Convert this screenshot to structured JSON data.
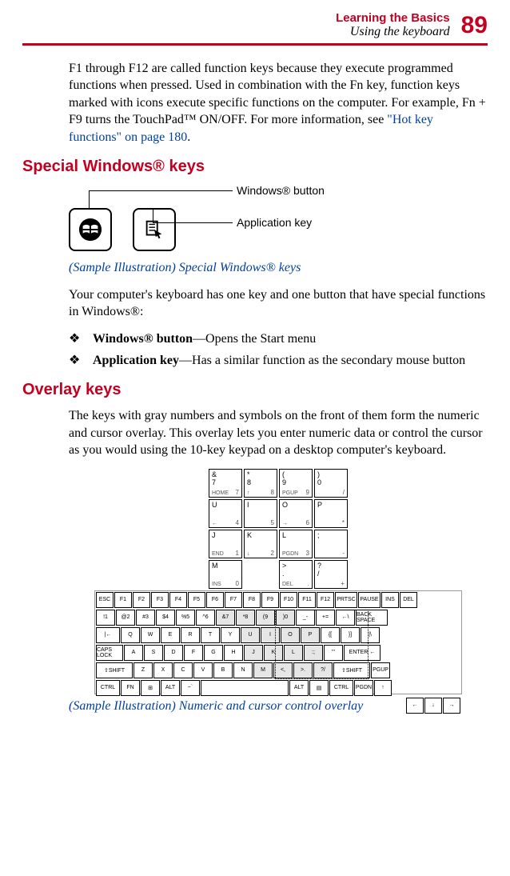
{
  "header": {
    "chapter": "Learning the Basics",
    "section": "Using the keyboard",
    "page_number": "89"
  },
  "intro": {
    "text_before_link": "F1 through F12 are called function keys because they execute programmed functions when pressed. Used in combination with the Fn key, function keys marked with icons execute specific functions on the computer. For example, Fn + F9 turns the TouchPad™ ON/OFF. For more information, see ",
    "link_text": "\"Hot key functions\" on page 180",
    "text_after_link": "."
  },
  "special_windows": {
    "heading": "Special Windows® keys",
    "fig_labels": {
      "windows_button": "Windows® button",
      "application_key": "Application key"
    },
    "caption": "(Sample Illustration) Special Windows® keys",
    "lead_in": "Your computer's keyboard has one key and one button that have special functions in Windows®:",
    "bullets": [
      {
        "strong": "Windows® button",
        "rest": "—Opens the Start menu"
      },
      {
        "strong": "Application key",
        "rest": "—Has a similar function as the secondary mouse button"
      }
    ]
  },
  "overlay": {
    "heading": "Overlay keys",
    "para": "The keys with gray numbers and symbols on the front of them form the numeric and cursor overlay. This overlay lets you enter numeric data or control the cursor as you would using the 10-key keypad on a desktop computer's keyboard.",
    "caption": "(Sample Illustration) Numeric and cursor control overlay",
    "magnified_rows": [
      [
        {
          "tl": "&",
          "sub": "7",
          "bl": "HOME",
          "br": "7"
        },
        {
          "tl": "*",
          "sub": "8",
          "bl": "↑",
          "br": "8"
        },
        {
          "tl": "(",
          "sub": "9",
          "bl": "PGUP",
          "br": "9"
        },
        {
          "tl": ")",
          "sub": "0",
          "bl": "",
          "br": "/"
        }
      ],
      [
        {
          "tl": "U",
          "bl": "←",
          "br": "4"
        },
        {
          "tl": "I",
          "bl": "",
          "br": "5"
        },
        {
          "tl": "O",
          "bl": "→",
          "br": "6"
        },
        {
          "tl": "P",
          "bl": "",
          "br": "*"
        }
      ],
      [
        {
          "tl": "J",
          "bl": "END",
          "br": "1"
        },
        {
          "tl": "K",
          "bl": "↓",
          "br": "2"
        },
        {
          "tl": "L",
          "bl": "PGDN",
          "br": "3"
        },
        {
          "tl": ";",
          "bl": "",
          "br": "-"
        }
      ],
      [
        {
          "tl": "M",
          "bl": "INS",
          "br": "0"
        },
        null,
        {
          "tl": ">",
          "sub": ".",
          "bl": "DEL",
          "br": "."
        },
        {
          "tl": "?",
          "sub": "/",
          "bl": "",
          "br": "+"
        }
      ]
    ],
    "full_keyboard_rows": [
      [
        "ESC",
        "F1",
        "F2",
        "F3",
        "F4",
        "F5",
        "F6",
        "F7",
        "F8",
        "F9",
        "F10",
        "F11",
        "F12",
        "PRTSC",
        "PAUSE",
        "INS",
        "DEL"
      ],
      [
        "!1",
        "@2",
        "#3",
        "$4",
        "%5",
        "^6",
        "&7",
        "*8",
        "(9",
        ")0",
        "_-",
        "+=",
        "←\\",
        "BACK SPACE"
      ],
      [
        "|←",
        "Q",
        "W",
        "E",
        "R",
        "T",
        "Y",
        "U",
        "I",
        "O",
        "P",
        "{[",
        "}]",
        "|\\"
      ],
      [
        "CAPS LOCK",
        "A",
        "S",
        "D",
        "F",
        "G",
        "H",
        "J",
        "K",
        "L",
        ":;",
        "\"'",
        "ENTER ←"
      ],
      [
        "⇧SHIFT",
        "Z",
        "X",
        "C",
        "V",
        "B",
        "N",
        "M",
        "<,",
        ">.",
        "?/",
        "⇧SHIFT",
        "PGUP"
      ],
      [
        "CTRL",
        "FN",
        "⊞",
        "ALT",
        "~`",
        "",
        "ALT",
        "▤",
        "CTRL",
        "PGDN",
        "↑"
      ],
      [
        "←",
        "↓",
        "→"
      ]
    ],
    "highlighted_coords": "numeric/cursor overlay block on rows 2-5, columns 7-10"
  }
}
